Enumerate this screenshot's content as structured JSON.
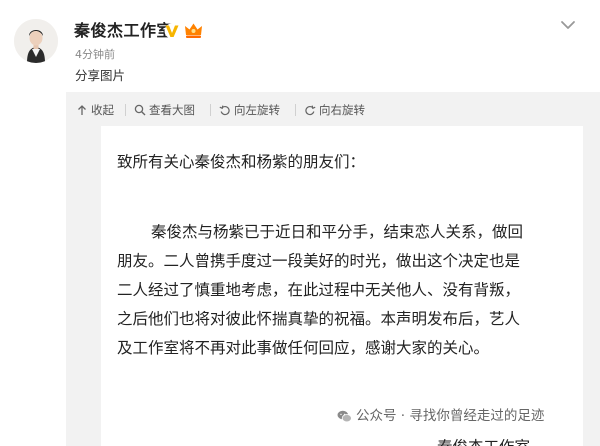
{
  "post": {
    "author": "秦俊杰工作室",
    "time": "4分钟前",
    "share_text": "分享图片"
  },
  "toolbar": {
    "collapse": "收起",
    "view_large": "查看大图",
    "rotate_left": "向左旋转",
    "rotate_right": "向右旋转"
  },
  "letter": {
    "greeting": "致所有关心秦俊杰和杨紫的朋友们：",
    "lines": [
      "秦俊杰与杨紫已于近日和平分手，结束恋人关系，做回",
      "朋友。二人曾携手度过一段美好的时光，做出这个决定也是",
      "二人经过了慎重地考虑，在此过程中无关他人、没有背叛，",
      "之后他们也将对彼此怀揣真挚的祝福。本声明发布后，艺人",
      "及工作室将不再对此事做任何回应，感谢大家的关心。"
    ],
    "signature": "秦俊杰工作室"
  },
  "watermark": {
    "text": "公众号 · 寻找你曾经走过的足迹"
  },
  "icons": {
    "verified": "verified-v-icon",
    "member": "member-crown-icon",
    "more": "chevron-down-icon"
  },
  "colors": {
    "verified": "#f7b500",
    "member": "#ff8200",
    "panel": "#f2f2f2"
  }
}
